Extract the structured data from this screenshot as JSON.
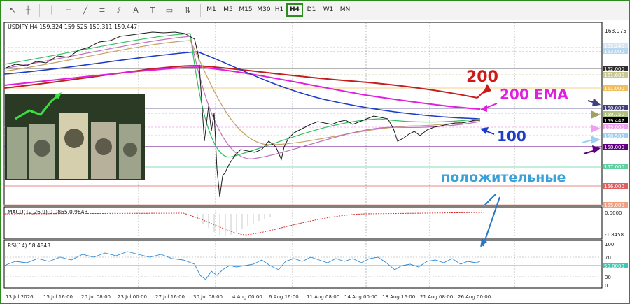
{
  "toolbar": {
    "timeframes": [
      "M1",
      "M5",
      "M15",
      "M30",
      "H1",
      "H4",
      "D1",
      "W1",
      "MN"
    ],
    "active_timeframe": "H4"
  },
  "chart_header": "USDJPY,H4  159.324 159.525 159.311 159.447",
  "price_axis": {
    "ticks": [
      "163.975",
      "162.000",
      "161.000",
      "160.000",
      "159.447",
      "158.000",
      "157.000",
      "156.000",
      "155.000"
    ],
    "badges": [
      {
        "text": "163.240",
        "color": "#d8e4f0"
      },
      {
        "text": "163.000",
        "color": "#b8d8f0"
      },
      {
        "text": "162.000",
        "color": "#303030"
      },
      {
        "text": "161.600",
        "color": "#c8c890"
      },
      {
        "text": "161.000",
        "color": "#f0c060"
      },
      {
        "text": "160.000",
        "color": "#404080"
      },
      {
        "text": "159.750",
        "color": "#b0c080"
      },
      {
        "text": "159.447",
        "color": "#000000"
      },
      {
        "text": "159.000",
        "color": "#f0a0f0"
      },
      {
        "text": "158.500",
        "color": "#a0d0f0"
      },
      {
        "text": "158.000",
        "color": "#600080"
      },
      {
        "text": "157.000",
        "color": "#60d0a0"
      },
      {
        "text": "156.000",
        "color": "#e06060"
      },
      {
        "text": "155.000",
        "color": "#f0a080"
      }
    ]
  },
  "annotations": {
    "label_200": "200",
    "label_200_ema": "200 EMA",
    "label_100": "100",
    "label_positive": "положительные"
  },
  "macd": {
    "title": "MACD(12,26,9) 0.0865 0.9643",
    "ticks": [
      "0.0000",
      "-1.8458"
    ]
  },
  "rsi": {
    "title": "RSI(14) 58.4843",
    "ticks": [
      "100",
      "70",
      "50.0000",
      "30",
      "0"
    ]
  },
  "time_axis": [
    "13 Jul 2026",
    "15 Jul 16:00",
    "20 Jul 08:00",
    "23 Jul 00:00",
    "27 Jul 16:00",
    "30 Jul 08:00",
    "4 Aug 00:00",
    "6 Aug 16:00",
    "11 Aug 08:00",
    "14 Aug 00:00",
    "18 Aug 16:00",
    "21 Aug 08:00",
    "26 Aug 00:00"
  ],
  "colors": {
    "frame": "#2e8b1e",
    "ema200": "#c02020",
    "ema200_label": "#e020e0",
    "ma100": "#1e3cc8",
    "positive": "#3aa0d8",
    "price_line": "#1a1a1a"
  }
}
